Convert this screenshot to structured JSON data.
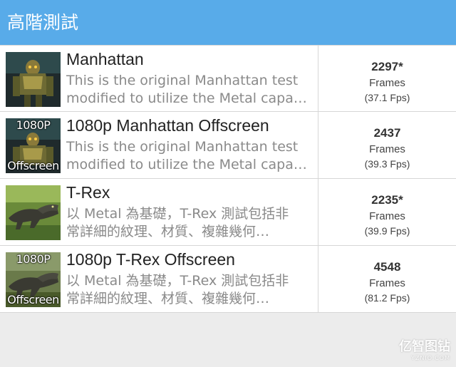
{
  "header": {
    "title": "高階測試"
  },
  "tests": [
    {
      "title": "Manhattan",
      "desc_line1": "This is the original Manhattan test",
      "desc_line2": "modified to utilize the Metal capa…",
      "thumb_top": "",
      "thumb_bottom": "",
      "score": "2297*",
      "frames_label": "Frames",
      "fps": "(37.1 Fps)"
    },
    {
      "title": "1080p Manhattan Offscreen",
      "desc_line1": "This is the original Manhattan test",
      "desc_line2": "modified to utilize the Metal capa…",
      "thumb_top": "1080P",
      "thumb_bottom": "Offscreen",
      "score": "2437",
      "frames_label": "Frames",
      "fps": "(39.3 Fps)"
    },
    {
      "title": "T-Rex",
      "desc_line1": "以 Metal 為基礎，T-Rex 測試包括非",
      "desc_line2": "常詳細的紋理、材質、複雜幾何…",
      "thumb_top": "",
      "thumb_bottom": "",
      "score": "2235*",
      "frames_label": "Frames",
      "fps": "(39.9 Fps)"
    },
    {
      "title": "1080p T-Rex Offscreen",
      "desc_line1": "以 Metal 為基礎，T-Rex 測試包括非",
      "desc_line2": "常詳細的紋理、材質、複雜幾何…",
      "thumb_top": "1080P",
      "thumb_bottom": "Offscreen",
      "score": "4548",
      "frames_label": "Frames",
      "fps": "(81.2 Fps)"
    }
  ],
  "watermark": {
    "main": "亿智图钻",
    "sub": "YZNIO.COM"
  },
  "colors": {
    "header_bg": "#58abe9",
    "page_bg": "#ececec",
    "row_bg": "#ffffff",
    "desc_text": "#8a8a8a"
  },
  "icons": [
    "manhattan-robot-thumbnail",
    "trex-dinosaur-thumbnail"
  ]
}
